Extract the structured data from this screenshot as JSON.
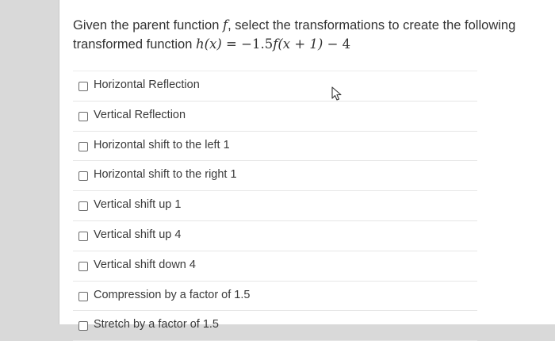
{
  "question": {
    "text_before": "Given the parent function ",
    "f_symbol": "f",
    "text_after": ", select the transformations to create the following transformed function ",
    "formula": {
      "lhs": "h(x)",
      "eq": " = ",
      "coef": "−1.5",
      "f_sym": "f",
      "arg": "(x + 1)",
      "tail": " − 4"
    }
  },
  "options": [
    {
      "label": "Horizontal Reflection"
    },
    {
      "label": "Vertical Reflection"
    },
    {
      "label": "Horizontal shift to the left 1"
    },
    {
      "label": "Horizontal shift to the right 1"
    },
    {
      "label": "Vertical shift up 1"
    },
    {
      "label": "Vertical shift up 4"
    },
    {
      "label": "Vertical shift down 4"
    },
    {
      "label": "Compression by a factor of 1.5"
    },
    {
      "label": "Stretch by a factor of 1.5"
    }
  ],
  "icons": {
    "cursor": "mouse-pointer-icon"
  }
}
